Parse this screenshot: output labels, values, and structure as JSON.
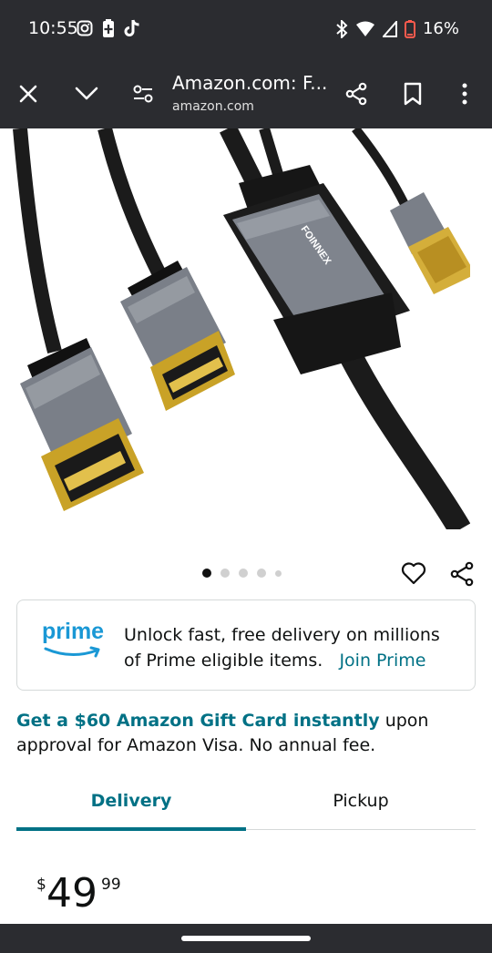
{
  "status_bar": {
    "time": "10:55",
    "battery": "16%",
    "icons": [
      "instagram-icon",
      "battery-saver-icon",
      "tiktok-icon",
      "bluetooth-icon",
      "wifi-icon",
      "signal-icon",
      "battery-icon"
    ]
  },
  "browser": {
    "title": "Amazon.com: F...",
    "domain": "amazon.com",
    "icons": [
      "close-icon",
      "chevron-down-icon",
      "site-settings-icon",
      "share-icon",
      "bookmark-icon",
      "more-icon"
    ]
  },
  "product": {
    "image_brand": "FOINNEX",
    "carousel_count": 5,
    "carousel_active": 1
  },
  "prime": {
    "logo": "prime",
    "text": "Unlock fast, free delivery on millions of Prime eligible items.",
    "link": "Join Prime"
  },
  "promo": {
    "bold": "Get a $60 Amazon Gift Card instantly",
    "rest": " upon approval for Amazon Visa. No annual fee."
  },
  "tabs": {
    "delivery": "Delivery",
    "pickup": "Pickup",
    "active": "Delivery"
  },
  "price": {
    "symbol": "$",
    "whole": "49",
    "fraction": "99"
  },
  "colors": {
    "bar": "#2b2c30",
    "link": "#007185",
    "prime_blue": "#1a98d5"
  }
}
